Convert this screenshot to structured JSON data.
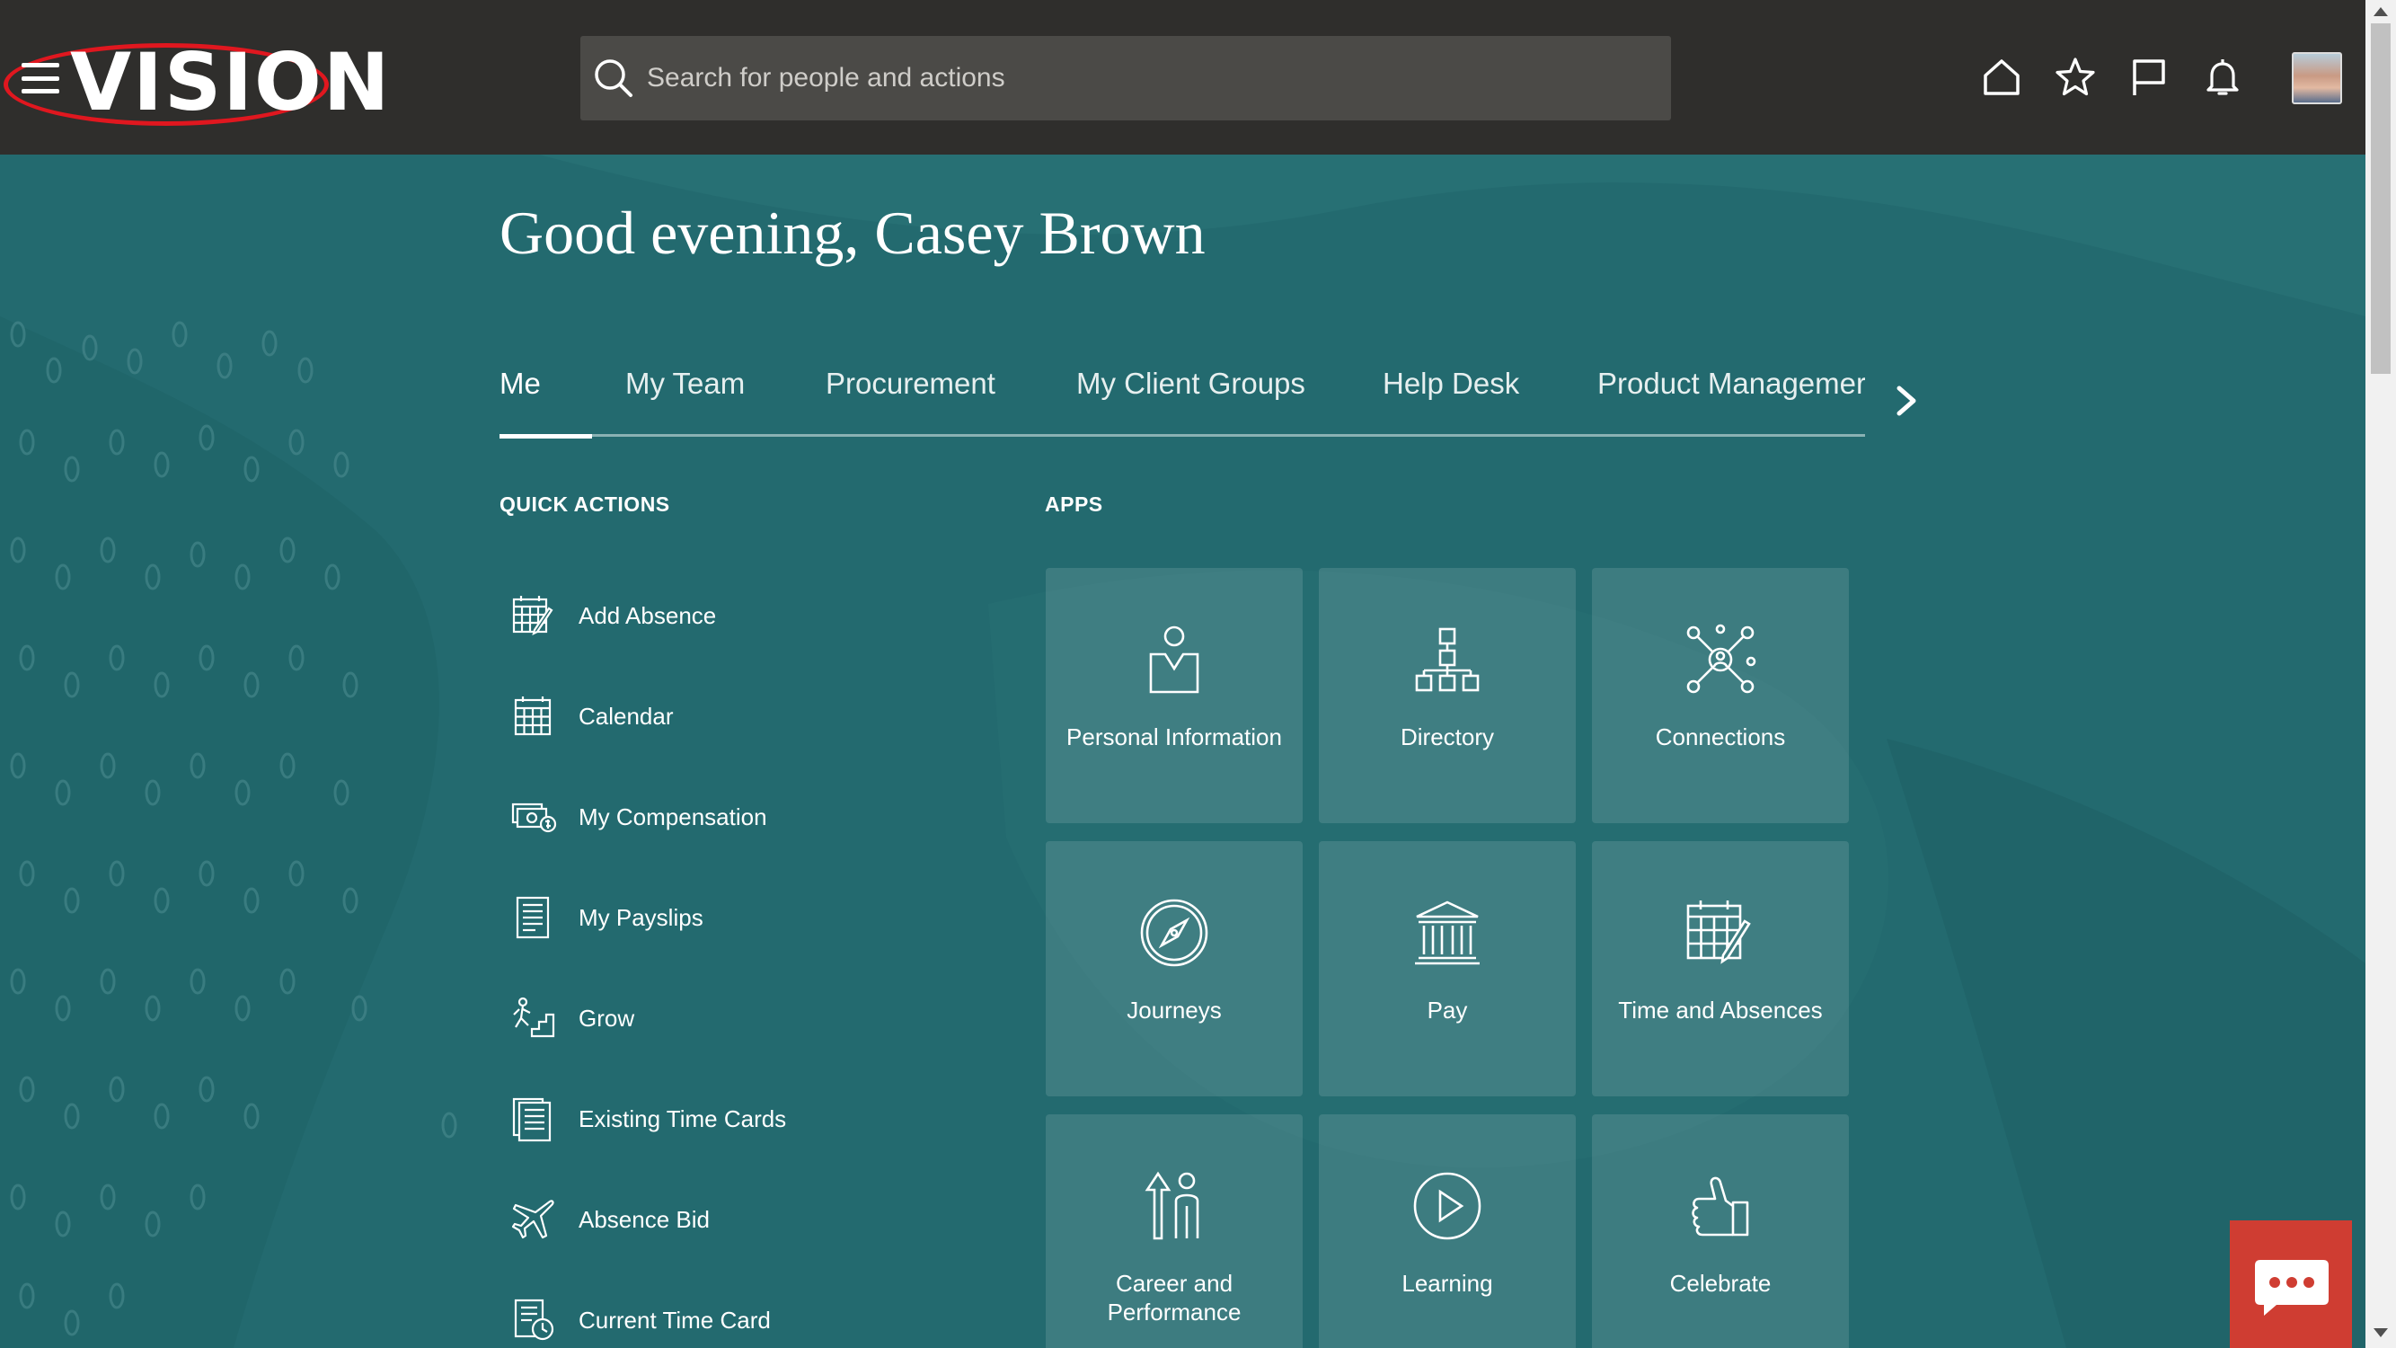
{
  "header": {
    "logo_text": "VISION",
    "search_placeholder": "Search for people and actions",
    "icons": [
      "menu-icon",
      "search-icon",
      "home-icon",
      "star-icon",
      "flag-icon",
      "bell-icon",
      "avatar"
    ]
  },
  "greeting": "Good evening, Casey Brown",
  "tabs": [
    {
      "label": "Me",
      "active": true
    },
    {
      "label": "My Team"
    },
    {
      "label": "Procurement"
    },
    {
      "label": "My Client Groups"
    },
    {
      "label": "Help Desk"
    },
    {
      "label": "Product Managemer"
    }
  ],
  "quick_actions": {
    "title": "QUICK ACTIONS",
    "items": [
      {
        "label": "Add Absence",
        "icon": "calendar-edit-icon"
      },
      {
        "label": "Calendar",
        "icon": "calendar-icon"
      },
      {
        "label": "My Compensation",
        "icon": "money-icon"
      },
      {
        "label": "My Payslips",
        "icon": "payslip-icon"
      },
      {
        "label": "Grow",
        "icon": "grow-icon"
      },
      {
        "label": "Existing Time Cards",
        "icon": "time-cards-icon"
      },
      {
        "label": "Absence Bid",
        "icon": "airplane-icon"
      },
      {
        "label": "Current Time Card",
        "icon": "time-card-clock-icon"
      }
    ]
  },
  "apps": {
    "title": "APPS",
    "items": [
      {
        "label": "Personal Information",
        "icon": "person-badge-icon"
      },
      {
        "label": "Directory",
        "icon": "org-chart-icon"
      },
      {
        "label": "Connections",
        "icon": "network-icon"
      },
      {
        "label": "Journeys",
        "icon": "compass-icon"
      },
      {
        "label": "Pay",
        "icon": "bank-icon"
      },
      {
        "label": "Time and Absences",
        "icon": "calendar-edit-icon"
      },
      {
        "label": "Career and Performance",
        "icon": "career-icon"
      },
      {
        "label": "Learning",
        "icon": "play-icon"
      },
      {
        "label": "Celebrate",
        "icon": "thumbs-up-icon"
      }
    ]
  },
  "colors": {
    "header_bg": "#2f2e2c",
    "page_bg": "#236a6f",
    "chat_button": "#cf3d32",
    "logo_ring": "#e0171f"
  }
}
